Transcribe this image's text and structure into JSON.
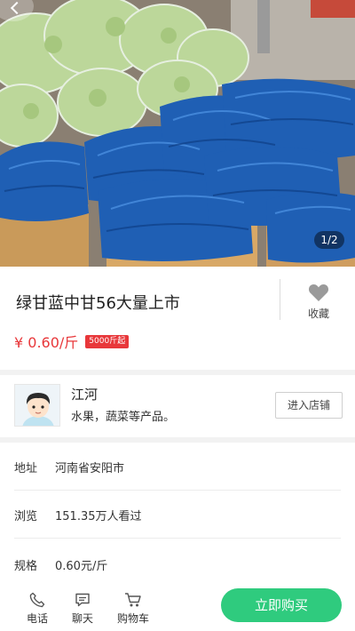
{
  "gallery": {
    "counter": "1/2",
    "back_icon": "back-icon"
  },
  "product": {
    "title": "绿甘蓝中甘56大量上市",
    "price": "¥ 0.60/斤",
    "min_order_badge": "5000斤起",
    "favorite_label": "收藏",
    "favorite_icon": "heart-icon"
  },
  "shop": {
    "name": "江河",
    "description": "水果，蔬菜等产品。",
    "enter_label": "进入店铺"
  },
  "info": [
    {
      "key": "地址",
      "value": "河南省安阳市"
    },
    {
      "key": "浏览",
      "value": "151.35万人看过"
    },
    {
      "key": "规格",
      "value": "0.60元/斤"
    }
  ],
  "bottom_bar": {
    "phone_label": "电话",
    "chat_label": "聊天",
    "cart_label": "购物车",
    "buy_label": "立即购买"
  },
  "colors": {
    "price_red": "#e8373a",
    "buy_green": "#2fcb7e"
  }
}
